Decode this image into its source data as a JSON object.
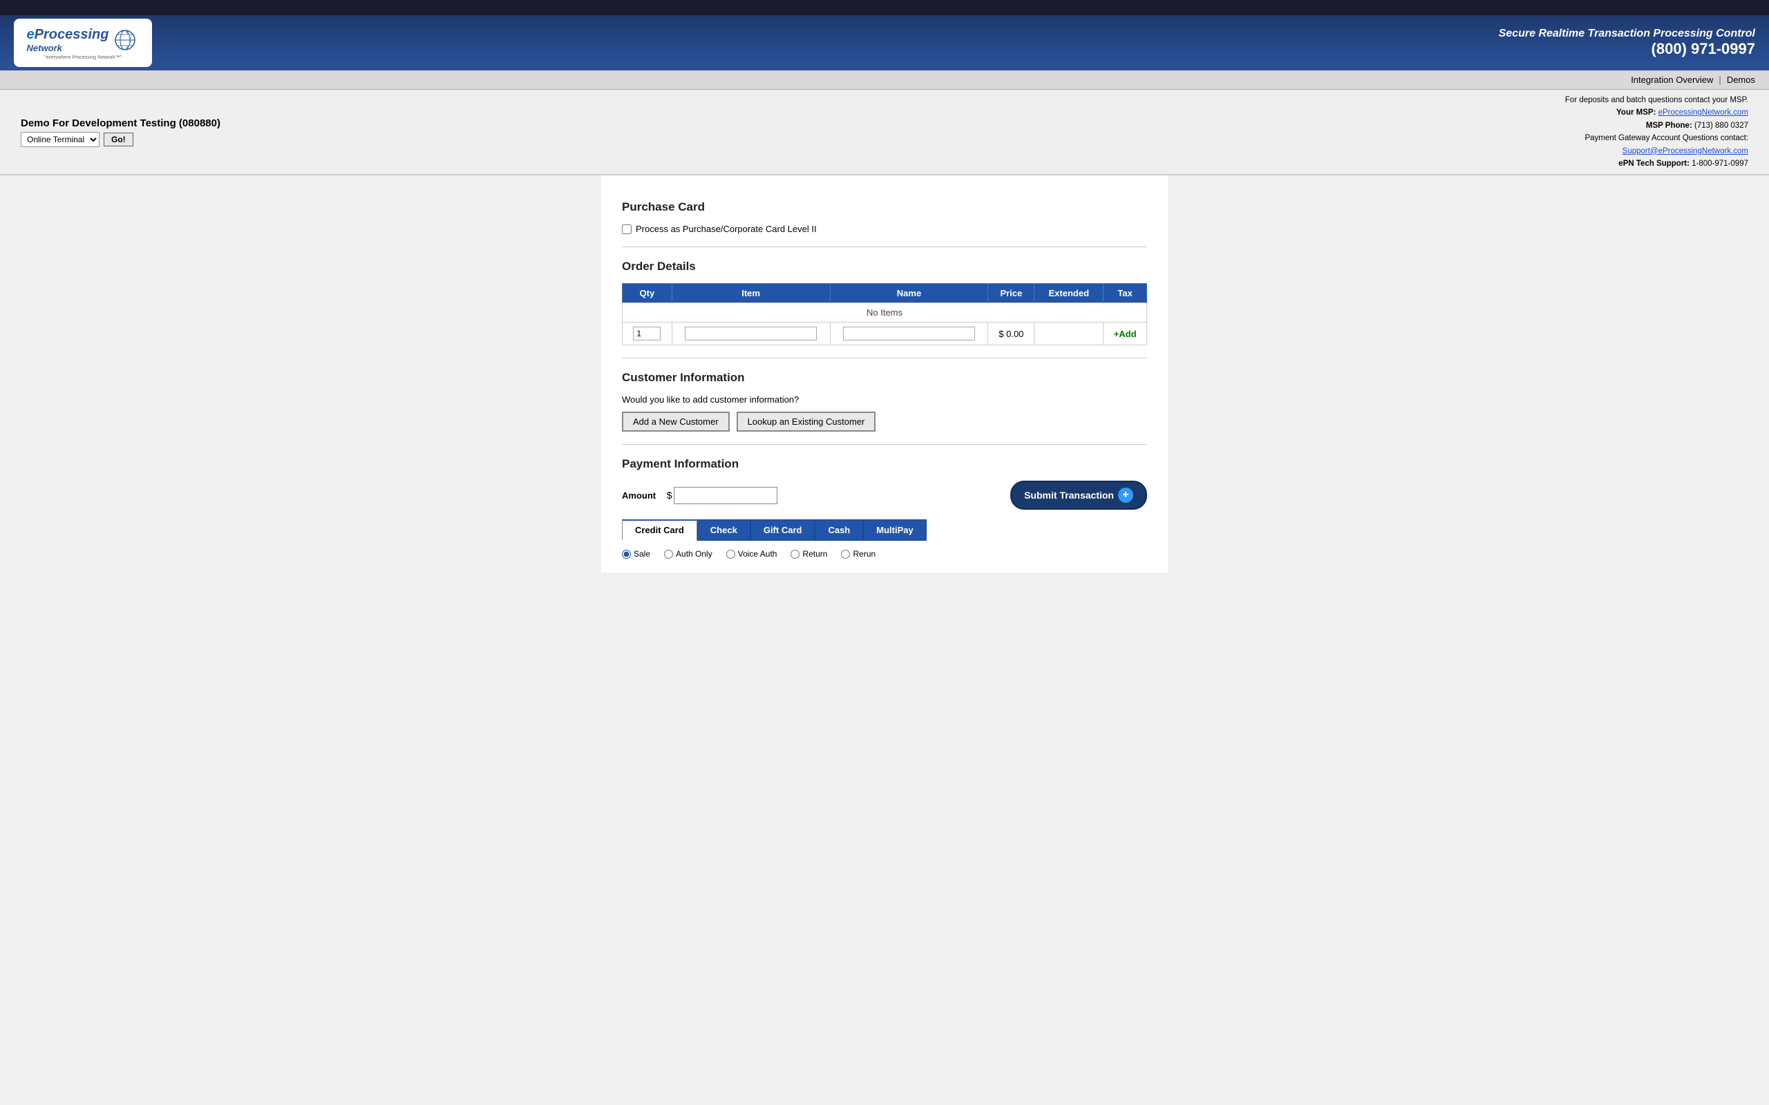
{
  "topbar": {},
  "header": {
    "tagline": "Secure Realtime Transaction Processing Control",
    "phone": "(800) 971-0997",
    "logo_line1": "eProcessing",
    "logo_line2": "Network",
    "logo_sub": "\"everywhere Processing Network™\""
  },
  "nav": {
    "integration_overview": "Integration Overview",
    "demos": "Demos",
    "separator": "|"
  },
  "infobar": {
    "merchant_name": "Demo For Development Testing (080880)",
    "terminal_label": "Online Terminal",
    "go_button": "Go!",
    "contact_intro": "For deposits and batch questions contact your MSP.",
    "msp_label": "Your MSP:",
    "msp_value": "eProcessingNetwork.com",
    "msp_phone_label": "MSP Phone:",
    "msp_phone": "(713) 880 0327",
    "pg_label": "Payment Gateway Account Questions contact:",
    "pg_email": "Support@eProcessingNetwork.com",
    "tech_label": "ePN Tech Support:",
    "tech_phone": "1-800-971-0997"
  },
  "purchase_card": {
    "title": "Purchase Card",
    "checkbox_label": "Process as Purchase/Corporate Card Level II"
  },
  "order_details": {
    "title": "Order Details",
    "columns": [
      "Qty",
      "Item",
      "Name",
      "Price",
      "Extended",
      "Tax"
    ],
    "no_items": "No Items",
    "row": {
      "qty": "1",
      "price": "$ 0.00"
    },
    "add_button": "+Add"
  },
  "customer_info": {
    "title": "Customer Information",
    "question": "Would you like to add customer information?",
    "add_button": "Add a New Customer",
    "lookup_button": "Lookup an Existing Customer"
  },
  "payment_info": {
    "title": "Payment Information",
    "amount_label": "Amount",
    "amount_prefix": "$",
    "submit_button": "Submit Transaction",
    "tabs": [
      {
        "label": "Credit Card",
        "active": true
      },
      {
        "label": "Check",
        "active": false
      },
      {
        "label": "Gift Card",
        "active": false
      },
      {
        "label": "Cash",
        "active": false
      },
      {
        "label": "MultiPay",
        "active": false
      }
    ],
    "radio_options": [
      "Sale",
      "Auth Only",
      "Voice Auth",
      "Return",
      "Rerun"
    ]
  }
}
